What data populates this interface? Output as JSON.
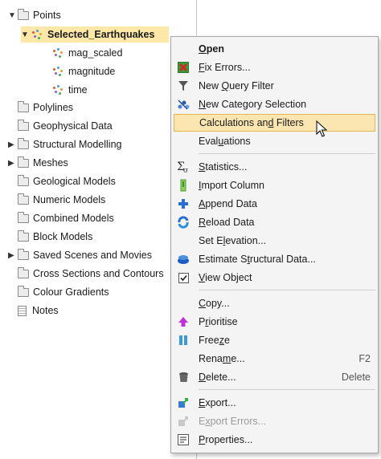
{
  "tree": {
    "points": "Points",
    "selected": "Selected_Earthquakes",
    "children": [
      "mag_scaled",
      "magnitude",
      "time"
    ],
    "items": [
      {
        "label": "Polylines",
        "expandable": false
      },
      {
        "label": "Geophysical Data",
        "expandable": false
      },
      {
        "label": "Structural Modelling",
        "expandable": true
      },
      {
        "label": "Meshes",
        "expandable": true
      },
      {
        "label": "Geological Models",
        "expandable": false
      },
      {
        "label": "Numeric Models",
        "expandable": false
      },
      {
        "label": "Combined Models",
        "expandable": false
      },
      {
        "label": "Block Models",
        "expandable": false
      },
      {
        "label": "Saved Scenes and Movies",
        "expandable": true
      },
      {
        "label": "Cross Sections and Contours",
        "expandable": false
      },
      {
        "label": "Colour Gradients",
        "expandable": false
      },
      {
        "label": "Notes",
        "expandable": false
      }
    ]
  },
  "menu": {
    "items": [
      {
        "pre": "",
        "key": "O",
        "post": "pen",
        "icon": "none",
        "bold": true
      },
      {
        "pre": "",
        "key": "F",
        "post": "ix Errors...",
        "icon": "fix-errors-icon"
      },
      {
        "pre": "New ",
        "key": "Q",
        "post": "uery Filter",
        "icon": "filter-icon"
      },
      {
        "pre": "",
        "key": "N",
        "post": "ew Category Selection",
        "icon": "category-selection-icon"
      },
      {
        "pre": "Calculations an",
        "key": "d",
        "post": " Filters",
        "icon": "none",
        "highlighted": true
      },
      {
        "pre": "Eval",
        "key": "u",
        "post": "ations",
        "icon": "none"
      },
      {
        "pre": "",
        "key": "S",
        "post": "tatistics...",
        "icon": "statistics-icon"
      },
      {
        "pre": "",
        "key": "I",
        "post": "mport Column",
        "icon": "import-column-icon"
      },
      {
        "pre": "",
        "key": "A",
        "post": "ppend Data",
        "icon": "append-data-icon"
      },
      {
        "pre": "",
        "key": "R",
        "post": "eload Data",
        "icon": "reload-icon"
      },
      {
        "pre": "Set E",
        "key": "l",
        "post": "evation...",
        "icon": "none"
      },
      {
        "pre": "Estimate S",
        "key": "t",
        "post": "ructural Data...",
        "icon": "structural-data-icon"
      },
      {
        "pre": "",
        "key": "V",
        "post": "iew Object",
        "icon": "checkbox-checked-icon"
      },
      {
        "pre": "",
        "key": "C",
        "post": "opy...",
        "icon": "none"
      },
      {
        "pre": "P",
        "key": "r",
        "post": "ioritise",
        "icon": "prioritise-arrow-icon"
      },
      {
        "pre": "Free",
        "key": "z",
        "post": "e",
        "icon": "freeze-icon"
      },
      {
        "pre": "Rena",
        "key": "m",
        "post": "e...",
        "icon": "none",
        "shortcut": "F2"
      },
      {
        "pre": "",
        "key": "D",
        "post": "elete...",
        "icon": "trash-icon",
        "shortcut": "Delete"
      },
      {
        "pre": "",
        "key": "E",
        "post": "xport...",
        "icon": "export-icon"
      },
      {
        "pre": "E",
        "key": "x",
        "post": "port Errors...",
        "icon": "export-disabled-icon",
        "disabled": true
      },
      {
        "pre": "",
        "key": "P",
        "post": "roperties...",
        "icon": "properties-icon"
      }
    ],
    "separators_after": [
      5,
      12,
      17
    ]
  }
}
